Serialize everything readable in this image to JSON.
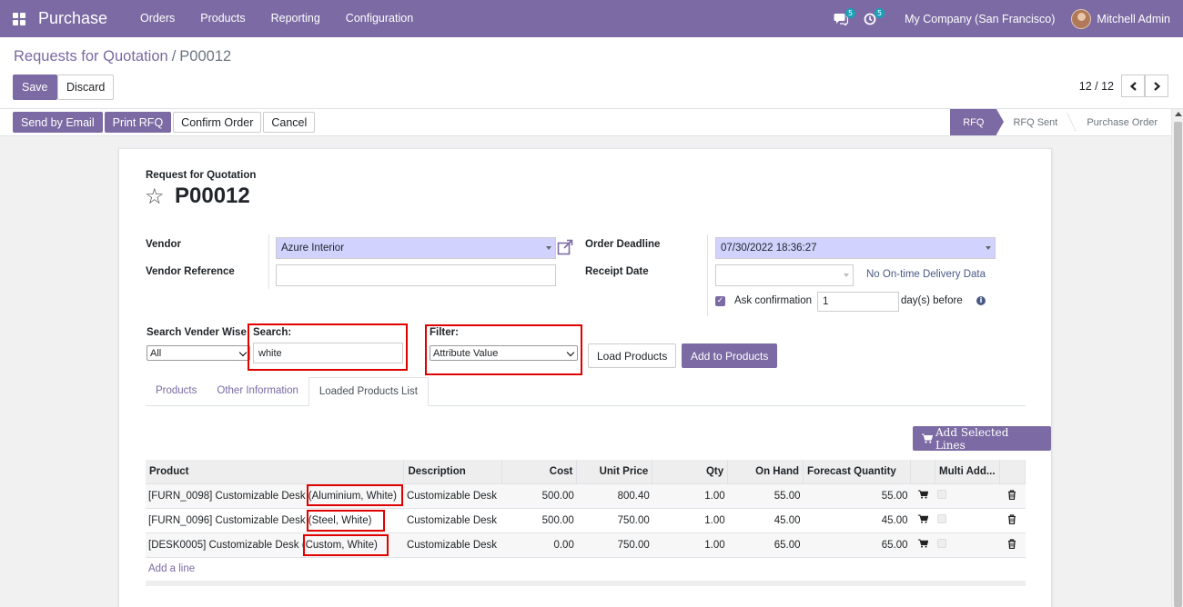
{
  "navbar": {
    "app_name": "Purchase",
    "menu": [
      "Orders",
      "Products",
      "Reporting",
      "Configuration"
    ],
    "messages_badge": "5",
    "activities_badge": "5",
    "company": "My Company (San Francisco)",
    "user": "Mitchell Admin",
    "bg_color": "#7b6aa3"
  },
  "breadcrumb": {
    "parent": "Requests for Quotation",
    "separator": "/",
    "current": "P00012"
  },
  "control": {
    "save_label": "Save",
    "discard_label": "Discard",
    "pager": "12 / 12"
  },
  "statusbar": {
    "buttons": [
      "Send by Email",
      "Print RFQ",
      "Confirm Order",
      "Cancel"
    ],
    "stages": [
      "RFQ",
      "RFQ Sent",
      "Purchase Order"
    ],
    "active_stage": "RFQ"
  },
  "form": {
    "title_label": "Request for Quotation",
    "record_name": "P00012",
    "vendor_label": "Vendor",
    "vendor_value": "Azure Interior",
    "vendor_ref_label": "Vendor Reference",
    "vendor_ref_value": "",
    "order_deadline_label": "Order Deadline",
    "order_deadline_value": "07/30/2022 18:36:27",
    "receipt_date_label": "Receipt Date",
    "receipt_date_value": "",
    "no_delivery_data": "No On-time Delivery Data",
    "ask_confirmation_label": "Ask confirmation",
    "ask_confirmation_days": "1",
    "days_before": "day(s) before"
  },
  "search": {
    "vendor_wise_label": "Search Vender Wise",
    "vendor_wise_value": "All",
    "search_label": "Search:",
    "search_value": "white",
    "filter_label": "Filter:",
    "filter_value": "Attribute Value",
    "load_products": "Load Products",
    "add_to_products": "Add to Products"
  },
  "tabs": [
    "Products",
    "Other Information",
    "Loaded Products List"
  ],
  "active_tab": "Loaded Products List",
  "add_selected_lines": "Add Selected Lines",
  "table": {
    "headers": [
      "Product",
      "Description",
      "Cost",
      "Unit Price",
      "Qty",
      "On Hand",
      "Forecast Quantity",
      "",
      "Multi Add...",
      ""
    ],
    "rows": [
      {
        "code": "[FURN_0098] Customizable Desk",
        "variant": "(Aluminium, White)",
        "description": "Customizable Desk",
        "cost": "500.00",
        "unit_price": "800.40",
        "qty": "1.00",
        "on_hand": "55.00",
        "forecast": "55.00"
      },
      {
        "code": "[FURN_0096] Customizable Desk",
        "variant": "(Steel, White)",
        "description": "Customizable Desk",
        "cost": "500.00",
        "unit_price": "750.00",
        "qty": "1.00",
        "on_hand": "45.00",
        "forecast": "45.00"
      },
      {
        "code": "[DESK0005] Customizable Desk",
        "variant": "(Custom, White)",
        "description": "Customizable Desk",
        "cost": "0.00",
        "unit_price": "750.00",
        "qty": "1.00",
        "on_hand": "65.00",
        "forecast": "65.00"
      }
    ],
    "add_line": "Add a line"
  }
}
